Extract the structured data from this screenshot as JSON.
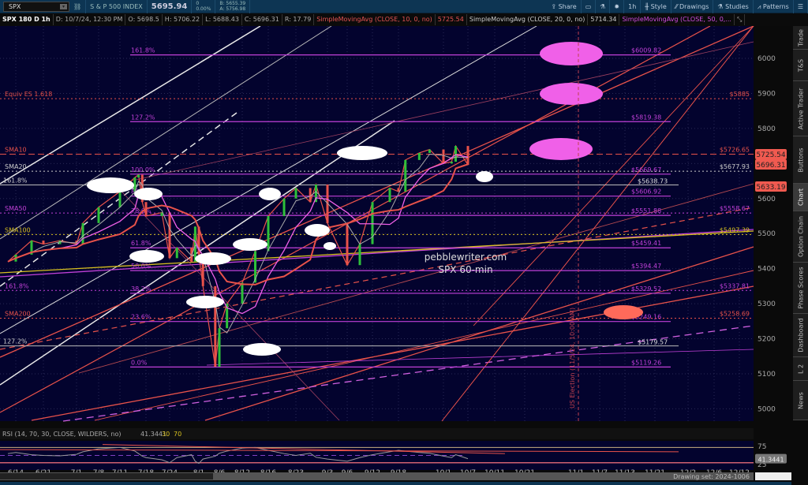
{
  "toolbar": {
    "symbol": "SPX",
    "description": "S & P 500 INDEX",
    "last": "5695.94",
    "change": "0",
    "change_pct": "0.00%",
    "bid": "B: 5655.39",
    "ask": "A: 5756.98",
    "share": "Share",
    "timeframe": "1h",
    "style": "Style",
    "drawings": "Drawings",
    "studies": "Studies",
    "patterns": "Patterns"
  },
  "info": {
    "title": "SPX 180 D 1h",
    "date": "D: 10/7/24, 12:30 PM",
    "open": "O: 5698.5",
    "high": "H: 5706.22",
    "low": "L: 5688.43",
    "close": "C: 5696.31",
    "range": "R: 17.79",
    "sma10": "SimpleMovingAvg (CLOSE, 10, 0, no)",
    "sma10_val": "5725.54",
    "sma20": "SimpleMovingAvg (CLOSE, 20, 0, no)",
    "sma20_val": "5714.34",
    "sma50": "SimpleMovingAvg (CLOSE, 50, 0,..."
  },
  "side_tabs": [
    "Trade",
    "T&S",
    "Active Trader",
    "Buttons",
    "Chart",
    "Option Chain",
    "Phase Scores",
    "Dashboard",
    "L 2",
    "News"
  ],
  "colors": {
    "bg": "#03032e",
    "fib": "#c040d8",
    "sma10": "#e8524a",
    "sma100": "#d8c020",
    "white": "#e0e0e0",
    "pink": "#f060e8",
    "salmon": "#ff6a5a"
  },
  "chart_data": {
    "type": "line",
    "title": "SPX 180 D 1h",
    "price_axis": {
      "min": 5000,
      "max": 6050,
      "ticks": [
        6000,
        5900,
        5800,
        5700,
        5600,
        5500,
        5400,
        5300,
        5200,
        5100,
        5000
      ]
    },
    "date_ticks": [
      "6/14",
      "6/21",
      "7/1",
      "7/8",
      "7/11",
      "7/18",
      "7/24",
      "8/1",
      "8/6",
      "8/12",
      "8/16",
      "8/23",
      "9/3",
      "9/6",
      "9/12",
      "9/18",
      "10/1",
      "10/7",
      "10/11",
      "10/21",
      "11/1",
      "11/7",
      "11/13",
      "11/21",
      "12/2",
      "12/6",
      "12/12"
    ],
    "price_series": [
      [
        "6/12",
        5420
      ],
      [
        "6/14",
        5440
      ],
      [
        "6/18",
        5480
      ],
      [
        "6/21",
        5470
      ],
      [
        "6/26",
        5480
      ],
      [
        "7/1",
        5470
      ],
      [
        "7/3",
        5530
      ],
      [
        "7/8",
        5575
      ],
      [
        "7/11",
        5620
      ],
      [
        "7/15",
        5660
      ],
      [
        "7/16",
        5668
      ],
      [
        "7/17",
        5590
      ],
      [
        "7/18",
        5550
      ],
      [
        "7/22",
        5560
      ],
      [
        "7/24",
        5430
      ],
      [
        "7/26",
        5460
      ],
      [
        "7/30",
        5420
      ],
      [
        "7/31",
        5520
      ],
      [
        "8/1",
        5440
      ],
      [
        "8/2",
        5350
      ],
      [
        "8/5",
        5120
      ],
      [
        "8/6",
        5230
      ],
      [
        "8/8",
        5300
      ],
      [
        "8/12",
        5360
      ],
      [
        "8/14",
        5450
      ],
      [
        "8/16",
        5550
      ],
      [
        "8/20",
        5600
      ],
      [
        "8/23",
        5630
      ],
      [
        "8/28",
        5590
      ],
      [
        "8/30",
        5640
      ],
      [
        "9/3",
        5530
      ],
      [
        "9/6",
        5410
      ],
      [
        "9/9",
        5470
      ],
      [
        "9/12",
        5590
      ],
      [
        "9/16",
        5630
      ],
      [
        "9/18",
        5620
      ],
      [
        "9/20",
        5710
      ],
      [
        "9/24",
        5730
      ],
      [
        "9/27",
        5740
      ],
      [
        "10/1",
        5700
      ],
      [
        "10/3",
        5705
      ],
      [
        "10/4",
        5750
      ],
      [
        "10/7",
        5696
      ]
    ],
    "levels": [
      {
        "label": "161.8%",
        "price": "$6009.82",
        "value": 6009.82,
        "color": "#c040d8"
      },
      {
        "label": "127.2%",
        "price": "$5819.38",
        "value": 5819.38,
        "color": "#c040d8"
      },
      {
        "label": "100.0%",
        "price": "$5669.67",
        "value": 5669.67,
        "color": "#c040d8"
      },
      {
        "label": "88.6%",
        "price": "$5606.92",
        "value": 5606.92,
        "color": "#c040d8"
      },
      {
        "label": "78.6%",
        "price": "$5551.88",
        "value": 5551.88,
        "color": "#c040d8"
      },
      {
        "label": "61.8%",
        "price": "$5459.41",
        "value": 5459.41,
        "color": "#c040d8"
      },
      {
        "label": "50.0%",
        "price": "$5394.47",
        "value": 5394.47,
        "color": "#c040d8"
      },
      {
        "label": "38.2%",
        "price": "$5329.52",
        "value": 5329.52,
        "color": "#c040d8"
      },
      {
        "label": "23.6%",
        "price": "$5249.16",
        "value": 5249.16,
        "color": "#c040d8"
      },
      {
        "label": "0.0%",
        "price": "$5119.26",
        "value": 5119.26,
        "color": "#c040d8"
      }
    ],
    "white_levels": [
      {
        "label": "161.8%",
        "price": "$5638.73",
        "value": 5638.73
      },
      {
        "label": "127.2%",
        "price": "$5179.57",
        "value": 5179.57
      }
    ],
    "ma_labels": [
      {
        "label": "Equiv ES 1.618",
        "price": "$5885",
        "value": 5885,
        "color": "#e8524a"
      },
      {
        "label": "SMA10",
        "price": "$5726.65",
        "value": 5726.65,
        "color": "#e8524a"
      },
      {
        "label": "SMA20",
        "price": "$5677.93",
        "value": 5677.93,
        "color": "#cccccc"
      },
      {
        "label": "SMA50",
        "price": "$5558.67",
        "value": 5558.67,
        "color": "#c040d8"
      },
      {
        "label": "SMA100",
        "price": "$5497.39",
        "value": 5497.39,
        "color": "#d8c020"
      },
      {
        "label": "161.8%",
        "price": "$5337.81",
        "value": 5337.81,
        "color": "#c040d8"
      },
      {
        "label": "SMA200",
        "price": "$5258.69",
        "value": 5258.69,
        "color": "#e8524a"
      }
    ],
    "price_badges": [
      {
        "text": "5725.54",
        "value": 5725.54
      },
      {
        "text": "5696.31",
        "value": 5696.31
      },
      {
        "text": "5633.19",
        "value": 5633.19
      }
    ],
    "annotations": {
      "site": "pebblewriter.com",
      "subtitle": "SPX 60-min",
      "event": "US Election (11/5/24, 10:00 AM)"
    },
    "rsi": {
      "header": "RSI (14, 70, 30, CLOSE, WILDERS, no)",
      "value": "41.3441",
      "ob": "30",
      "os": "70",
      "ticks": [
        "75",
        "25"
      ],
      "series": [
        55,
        58,
        52,
        50,
        49,
        53,
        60,
        68,
        72,
        62,
        55,
        48,
        44,
        38,
        30,
        44,
        52,
        34,
        28,
        40,
        48,
        56,
        62,
        70,
        72,
        64,
        55,
        50,
        56,
        45,
        40,
        34,
        44,
        52,
        60,
        64,
        62,
        58,
        56,
        48,
        44,
        52,
        41
      ]
    }
  },
  "statusbar": {
    "drawing_set": "Drawing set: 2024-1006"
  }
}
